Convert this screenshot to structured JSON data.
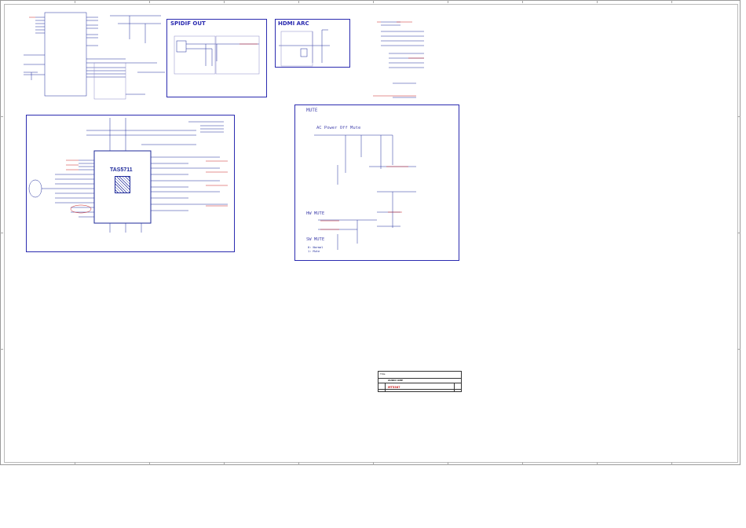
{
  "sections": {
    "spdif": {
      "title": "SPIDIF OUT"
    },
    "hdmi_arc": {
      "title": "HDMI ARC"
    },
    "mute": {
      "title": "MUTE",
      "ac_off": "AC Power Off Mute",
      "hw_mute": "HW MUTE",
      "sw_mute": "SW MUTE",
      "normal": "0: Normal",
      "mute_state": "1: Mute"
    },
    "amp": {
      "chip": "TAS5711"
    }
  },
  "title_block": {
    "project": "AUDIO AMP",
    "part": "MT5387",
    "label": "Title"
  },
  "colors": {
    "frame": "#2b2bb0",
    "net": "#cc2020",
    "wire": "#1e2a9a"
  }
}
